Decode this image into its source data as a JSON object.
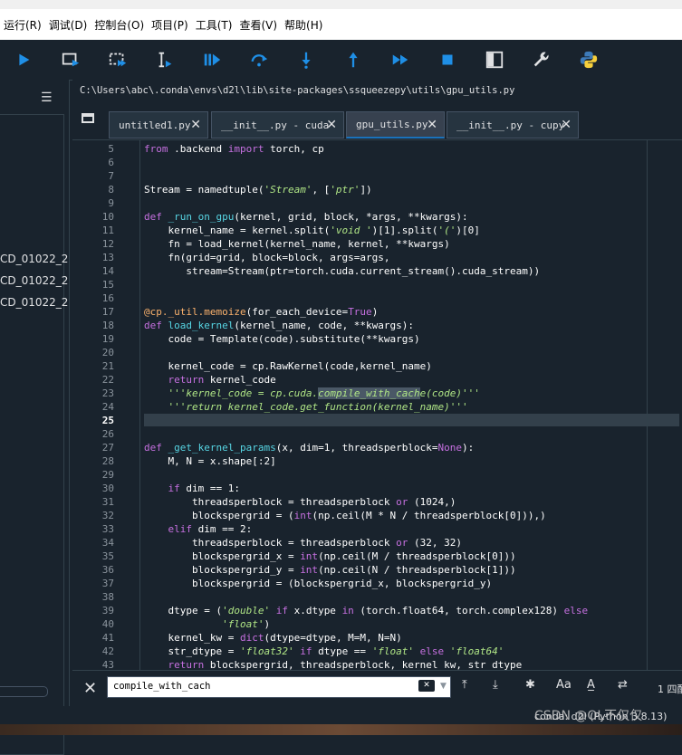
{
  "menu": [
    "运行(R)",
    "调试(D)",
    "控制台(O)",
    "项目(P)",
    "工具(T)",
    "查看(V)",
    "帮助(H)"
  ],
  "left_panel": {
    "items": [
      "CD_01022_2",
      "CD_01022_2",
      "CD_01022_2"
    ]
  },
  "path": "C:\\Users\\abc\\.conda\\envs\\d2l\\lib\\site-packages\\ssqueezepy\\utils\\gpu_utils.py",
  "tabs": [
    {
      "label": "untitled1.py"
    },
    {
      "label": "__init__.py - cuda"
    },
    {
      "label": "gpu_utils.py"
    },
    {
      "label": "__init__.py - cupy"
    }
  ],
  "editor": {
    "current_line": 25,
    "line_numbers": [
      5,
      6,
      7,
      8,
      9,
      10,
      11,
      12,
      13,
      14,
      15,
      16,
      17,
      18,
      19,
      20,
      21,
      22,
      23,
      24,
      25,
      26,
      27,
      28,
      29,
      30,
      31,
      32,
      33,
      34,
      35,
      36,
      37,
      38,
      39,
      40,
      41,
      42,
      43
    ],
    "code": [
      "from .backend import torch, cp",
      "",
      "",
      "Stream = namedtuple('Stream', ['ptr'])",
      "",
      "def _run_on_gpu(kernel, grid, block, *args, **kwargs):",
      "    kernel_name = kernel.split('void ')[1].split('(')[0]",
      "    fn = load_kernel(kernel_name, kernel, **kwargs)",
      "    fn(grid=grid, block=block, args=args,",
      "       stream=Stream(ptr=torch.cuda.current_stream().cuda_stream))",
      "",
      "",
      "@cp._util.memoize(for_each_device=True)",
      "def load_kernel(kernel_name, code, **kwargs):",
      "    code = Template(code).substitute(**kwargs)",
      "",
      "    kernel_code = cp.RawKernel(code,kernel_name)",
      "    return kernel_code",
      "    '''kernel_code = cp.cuda.compile_with_cache(code)'''",
      "    '''return kernel_code.get_function(kernel_name)'''",
      "",
      "",
      "def _get_kernel_params(x, dim=1, threadsperblock=None):",
      "    M, N = x.shape[:2]",
      "",
      "    if dim == 1:",
      "        threadsperblock = threadsperblock or (1024,)",
      "        blockspergrid = (int(np.ceil(M * N / threadsperblock[0])),)",
      "    elif dim == 2:",
      "        threadsperblock = threadsperblock or (32, 32)",
      "        blockspergrid_x = int(np.ceil(M / threadsperblock[0]))",
      "        blockspergrid_y = int(np.ceil(N / threadsperblock[1]))",
      "        blockspergrid = (blockspergrid_x, blockspergrid_y)",
      "",
      "    dtype = ('double' if x.dtype in (torch.float64, torch.complex128) else",
      "             'float')",
      "    kernel_kw = dict(dtype=dtype, M=M, N=N)",
      "    str_dtype = 'float32' if dtype == 'float' else 'float64'",
      "    return blockspergrid, threadsperblock, kernel_kw, str_dtype"
    ]
  },
  "find": {
    "value": "compile_with_cach",
    "count": "1 四配"
  },
  "status": {
    "text": "conda: d2l (Python 3.8.13)",
    "watermark": "CSDN @OL不仅仅"
  },
  "colors": {
    "background": "#19232d",
    "accent": "#1a72bb",
    "toolbar_icon": "#1f8fe6"
  }
}
